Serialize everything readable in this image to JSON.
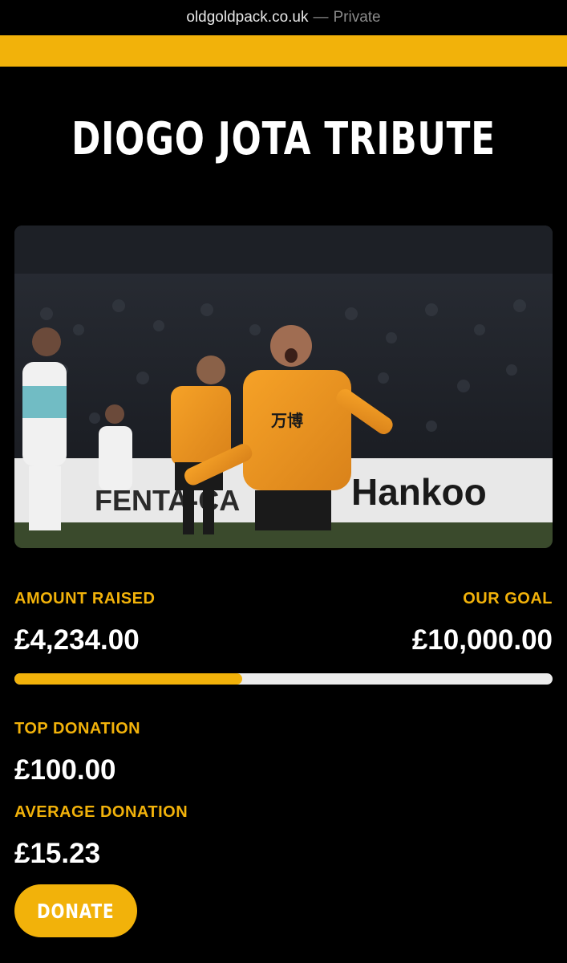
{
  "browser": {
    "host": "oldgoldpack.co.uk",
    "separator": "—",
    "mode": "Private"
  },
  "page": {
    "title": "DIOGO JOTA TRIBUTE"
  },
  "hero": {
    "alt": "Diogo Jota celebrating a goal in a Wolves shirt"
  },
  "fundraiser": {
    "raised_label": "AMOUNT RAISED",
    "raised_value": "£4,234.00",
    "goal_label": "OUR GOAL",
    "goal_value": "£10,000.00",
    "progress_fraction": 0.4234,
    "top_label": "TOP DONATION",
    "top_value": "£100.00",
    "avg_label": "AVERAGE DONATION",
    "avg_value": "£15.23"
  },
  "cta": {
    "donate_label": "DONATE"
  },
  "colors": {
    "accent": "#f2b20a",
    "background": "#000000",
    "track": "#ececec"
  }
}
